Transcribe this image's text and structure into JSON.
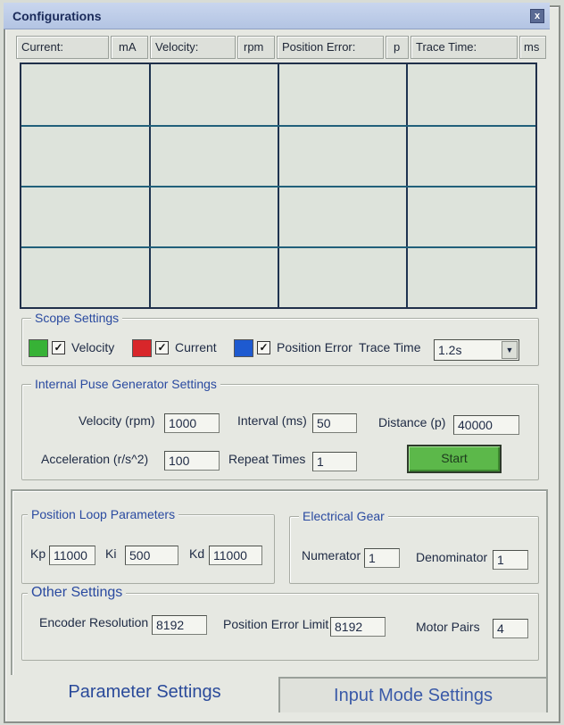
{
  "window": {
    "title": "Configurations",
    "close_glyph": "x"
  },
  "readouts": [
    {
      "label": "Current:",
      "unit": "mA"
    },
    {
      "label": "Velocity:",
      "unit": "rpm"
    },
    {
      "label": "Position Error:",
      "unit": "p"
    },
    {
      "label": "Trace Time:",
      "unit": "ms"
    }
  ],
  "scope_settings": {
    "title": "Scope Settings",
    "channels": [
      {
        "label": "Velocity",
        "color": "#37b236",
        "checked": true
      },
      {
        "label": "Current",
        "color": "#d8262a",
        "checked": true
      },
      {
        "label": "Position Error",
        "color": "#1e5ad0",
        "checked": true
      }
    ],
    "check_glyph": "✓",
    "trace_time_label": "Trace Time",
    "trace_time_value": "1.2s",
    "dropdown_glyph": "▼"
  },
  "pulse_generator": {
    "title": "Internal Puse Generator Settings",
    "velocity_label": "Velocity (rpm)",
    "velocity_value": "1000",
    "interval_label": "Interval (ms)",
    "interval_value": "50",
    "distance_label": "Distance (p)",
    "distance_value": "40000",
    "acceleration_label": "Acceleration  (r/s^2)",
    "acceleration_value": "100",
    "repeat_label": "Repeat Times",
    "repeat_value": "1",
    "start_label": "Start"
  },
  "position_loop": {
    "title": "Position Loop Parameters",
    "kp_label": "Kp",
    "kp_value": "11000",
    "ki_label": "Ki",
    "ki_value": "500",
    "kd_label": "Kd",
    "kd_value": "11000"
  },
  "electrical_gear": {
    "title": "Electrical Gear",
    "numerator_label": "Numerator",
    "numerator_value": "1",
    "denominator_label": "Denominator",
    "denominator_value": "1"
  },
  "other_settings": {
    "title": "Other Settings",
    "encoder_label": "Encoder Resolution",
    "encoder_value": "8192",
    "pos_err_label": "Position Error Limit",
    "pos_err_value": "8192",
    "motor_pairs_label": "Motor Pairs",
    "motor_pairs_value": "4"
  },
  "tabs": [
    {
      "label": "Parameter Settings",
      "active": true
    },
    {
      "label": "Input Mode Settings",
      "active": false
    }
  ]
}
